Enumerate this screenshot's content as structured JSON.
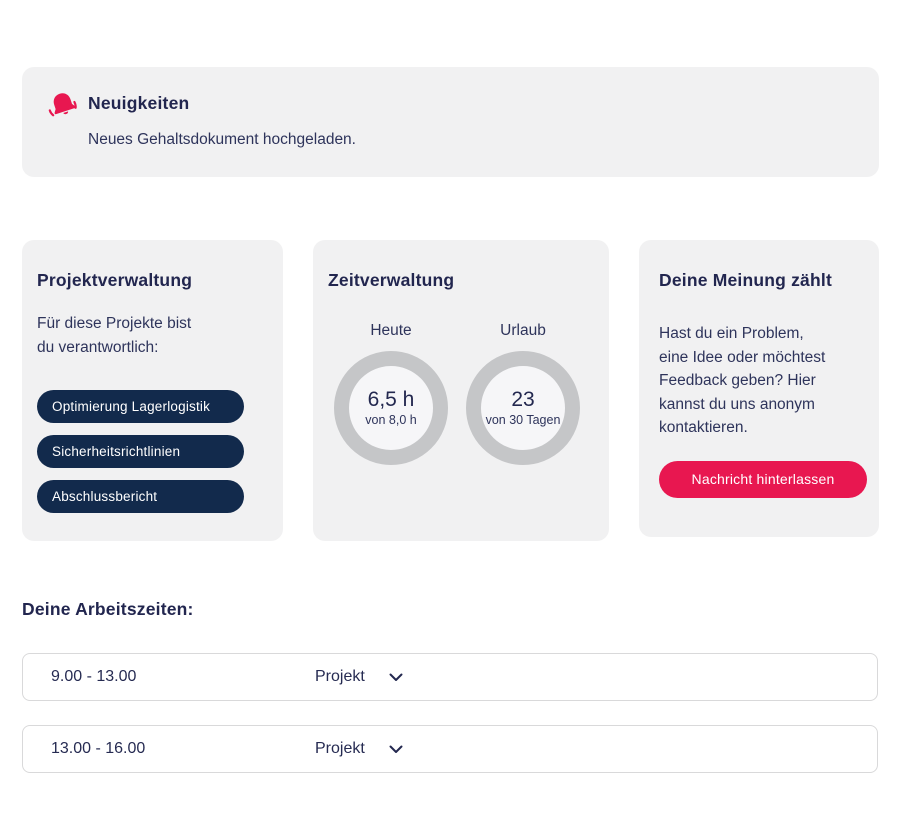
{
  "colors": {
    "accent_pink": "#e81750",
    "navy_heading": "#22264f",
    "pill_navy": "#122a4c",
    "card_background": "#f1f1f2",
    "ring_gray": "#c5c6c8",
    "row_border": "#d9d9da"
  },
  "banner": {
    "icon": "bell-ring-icon",
    "title": "Neuigkeiten",
    "message": "Neues Gehaltsdokument hochgeladen."
  },
  "cards": {
    "projects": {
      "title": "Projektverwaltung",
      "description": "Für diese Projekte bist\ndu verantwortlich:",
      "pills": [
        "Optimierung Lagerlogistik",
        "Sicherheitsrichtlinien",
        "Abschlussbericht"
      ]
    },
    "time": {
      "title": "Zeitverwaltung",
      "gauges": [
        {
          "label": "Heute",
          "value": "6,5 h",
          "sub": "von 8,0 h"
        },
        {
          "label": "Urlaub",
          "value": "23",
          "sub": "von 30 Tagen"
        }
      ]
    },
    "feedback": {
      "title": "Deine Meinung zählt",
      "description": "Hast du ein Problem,\neine Idee oder möchtest\nFeedback geben? Hier\nkannst du uns anonym\nkontaktieren.",
      "button_label": "Nachricht hinterlassen"
    }
  },
  "worktimes": {
    "heading": "Deine Arbeitszeiten:",
    "rows": [
      {
        "time": "9.00 - 13.00",
        "category": "Projekt",
        "icon": "chevron-down-icon"
      },
      {
        "time": "13.00 - 16.00",
        "category": "Projekt",
        "icon": "chevron-down-icon"
      }
    ]
  }
}
